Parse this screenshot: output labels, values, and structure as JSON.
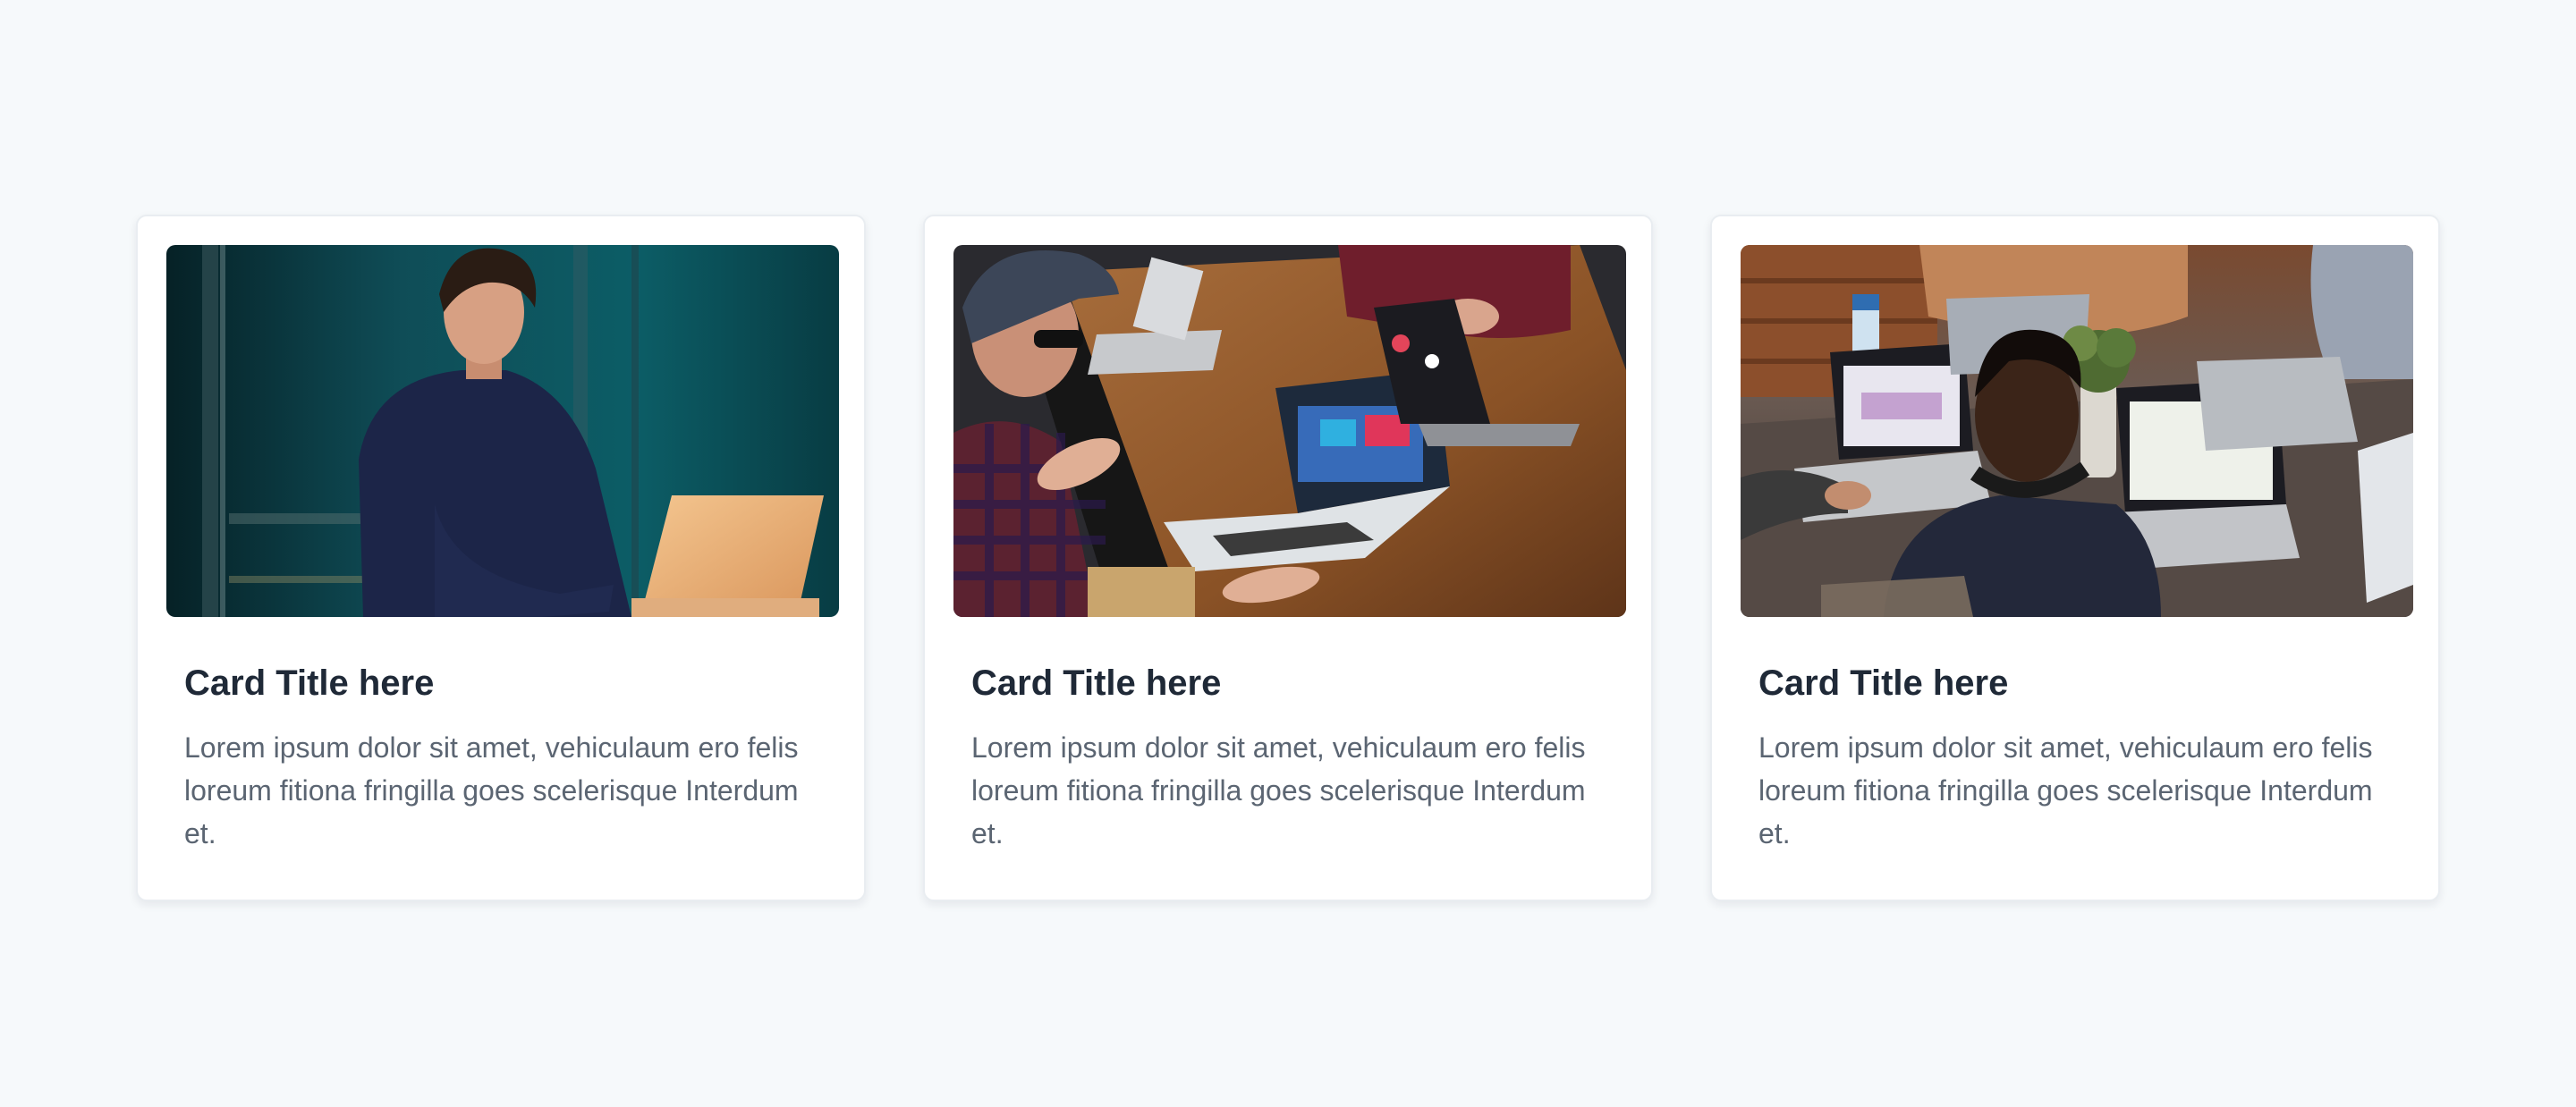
{
  "cards": [
    {
      "title": "Card Title here",
      "text": "Lorem ipsum dolor sit amet, vehiculaum ero felis loreum fitiona fringilla goes scelerisque Interdum et.",
      "image": "photo-man-working-on-laptop"
    },
    {
      "title": "Card Title here",
      "text": "Lorem ipsum dolor sit amet, vehiculaum ero felis loreum fitiona fringilla goes scelerisque Interdum et.",
      "image": "photo-team-meeting-around-table"
    },
    {
      "title": "Card Title here",
      "text": "Lorem ipsum dolor sit amet, vehiculaum ero felis loreum fitiona fringilla goes scelerisque Interdum et.",
      "image": "photo-coworking-people-with-laptops"
    }
  ],
  "colors": {
    "page_background": "#f6f9fb",
    "card_background": "#ffffff",
    "title": "#1f2937",
    "body_text": "#5b6572"
  }
}
